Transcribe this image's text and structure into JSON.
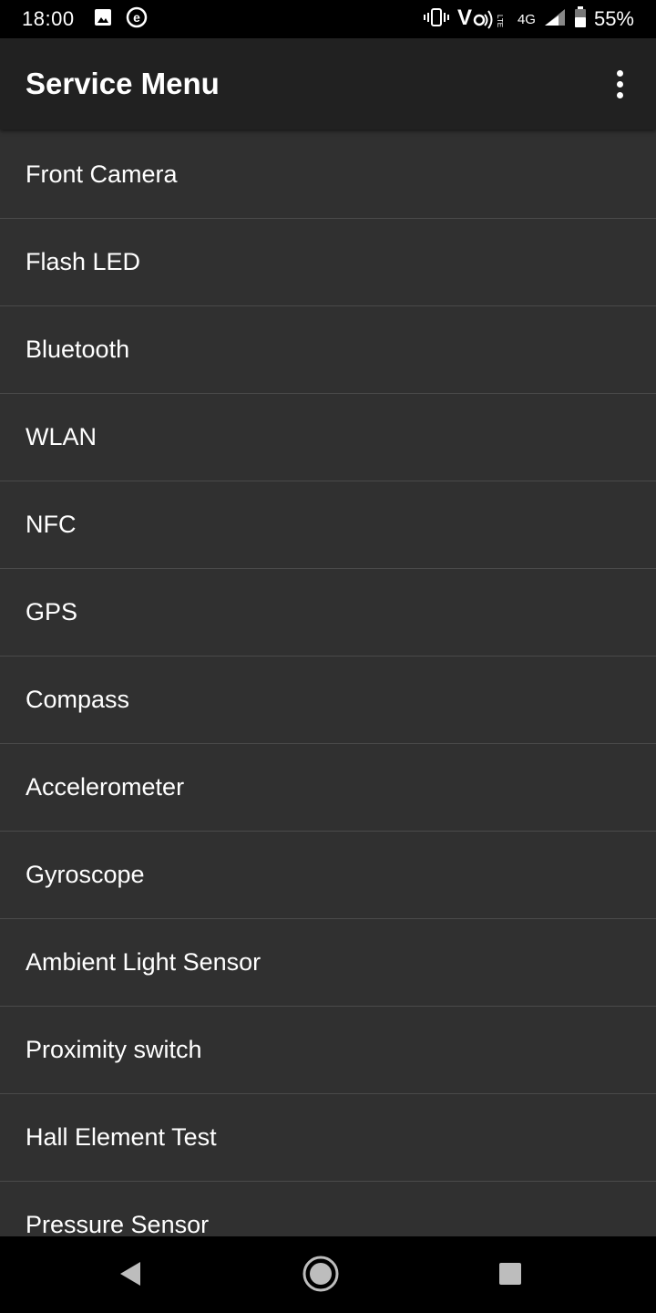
{
  "status_bar": {
    "time": "18:00",
    "network": "4G",
    "battery": "55%",
    "left_icons": [
      "image-icon",
      "e-icon"
    ],
    "right_icons": [
      "vibrate-icon",
      "volte-icon",
      "signal-icon",
      "battery-icon"
    ]
  },
  "app_bar": {
    "title": "Service Menu",
    "overflow_icon": "more-vert-icon"
  },
  "menu": {
    "items": [
      {
        "label": "Front Camera"
      },
      {
        "label": "Flash LED"
      },
      {
        "label": "Bluetooth"
      },
      {
        "label": "WLAN"
      },
      {
        "label": "NFC"
      },
      {
        "label": "GPS"
      },
      {
        "label": "Compass"
      },
      {
        "label": "Accelerometer"
      },
      {
        "label": "Gyroscope"
      },
      {
        "label": "Ambient Light Sensor"
      },
      {
        "label": "Proximity switch"
      },
      {
        "label": "Hall Element Test"
      },
      {
        "label": "Pressure Sensor"
      }
    ]
  },
  "nav_bar": {
    "buttons": [
      "back-icon",
      "home-icon",
      "recents-icon"
    ]
  },
  "colors": {
    "background": "#303030",
    "app_bar": "#212121",
    "divider": "#4a4a4a",
    "status_bar": "#000000",
    "nav_icon": "#bdbdbd"
  }
}
